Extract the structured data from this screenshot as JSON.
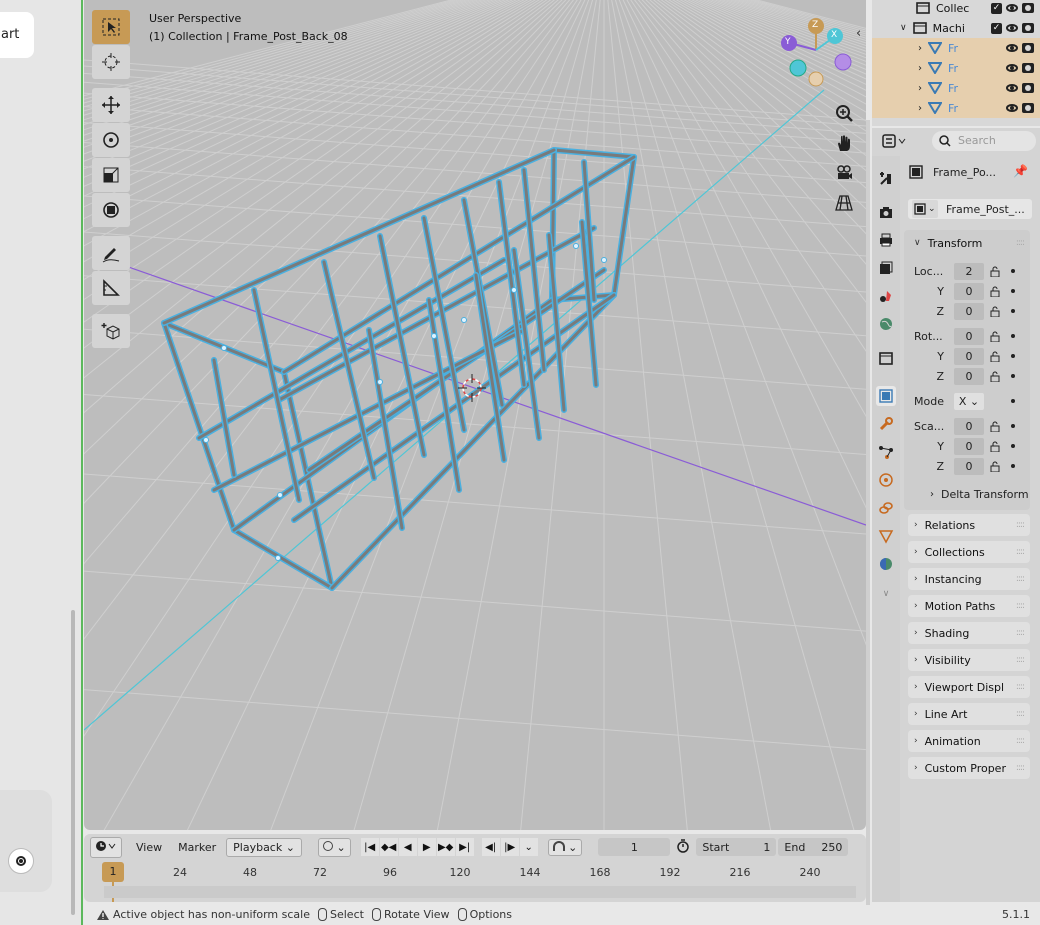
{
  "left_panel": {
    "card_text": "art"
  },
  "viewport": {
    "perspective_label": "User Perspective",
    "collection_label": "(1) Collection | Frame_Post_Back_08",
    "gizmo": {
      "z": "Z",
      "y": "Y",
      "x": "X"
    }
  },
  "timeline": {
    "menus": [
      "View",
      "Marker"
    ],
    "playback": "Playback",
    "current_frame": "1",
    "start_label": "Start",
    "start_value": "1",
    "end_label": "End",
    "end_value": "250",
    "current_marker": "1",
    "ticks": [
      "24",
      "48",
      "72",
      "96",
      "120",
      "144",
      "168",
      "192",
      "216",
      "240"
    ]
  },
  "statusbar": {
    "warning": "Active object has non-uniform scale",
    "select": "Select",
    "rotate": "Rotate View",
    "options": "Options",
    "version": "5.1.1"
  },
  "outliner": {
    "rows": [
      {
        "label": "Collec"
      },
      {
        "label": "Machi"
      },
      {
        "label": "Fr"
      },
      {
        "label": "Fr"
      },
      {
        "label": "Fr"
      },
      {
        "label": "Fr"
      }
    ]
  },
  "properties": {
    "search_placeholder": "Search",
    "object_name": "Frame_Po...",
    "datablock_name": "Frame_Post_...",
    "transform_title": "Transform",
    "location_label": "Loc...",
    "location": [
      "2",
      "0",
      "0"
    ],
    "rotation_label": "Rot...",
    "rotation": [
      "0",
      "0",
      "0"
    ],
    "mode_label": "Mode",
    "mode_value": "X",
    "scale_label": "Sca...",
    "scale": [
      "0",
      "0",
      "0"
    ],
    "axis_y": "Y",
    "axis_z": "Z",
    "delta_transform": "Delta Transform",
    "panels": [
      "Relations",
      "Collections",
      "Instancing",
      "Motion Paths",
      "Shading",
      "Visibility",
      "Viewport Displ",
      "Line Art",
      "Animation",
      "Custom Proper"
    ]
  },
  "colors": {
    "accent": "#c79a55",
    "selection": "#4ab0e0",
    "x_axis": "#8a5cd6",
    "y_axis": "#4fc6d6"
  }
}
